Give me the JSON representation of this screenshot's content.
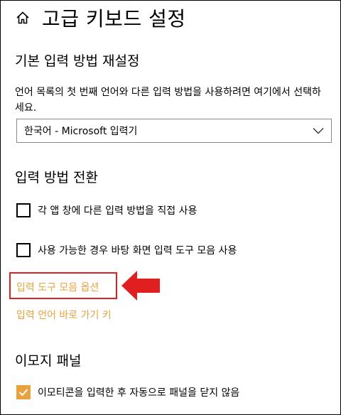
{
  "header": {
    "title": "고급 키보드 설정",
    "home_icon": "home-icon"
  },
  "default_input": {
    "title": "기본 입력 방법 재설정",
    "description": "언어 목록의 첫 번째 언어와 다른 입력 방법을 사용하려면 여기에서 선택하세요.",
    "selected": "한국어 - Microsoft 입력기"
  },
  "switching": {
    "title": "입력 방법 전환",
    "options": [
      {
        "label": "각 앱 창에 다른 입력 방법을 직접 사용",
        "checked": false
      },
      {
        "label": "사용 가능한 경우 바탕 화면 입력 도구 모음 사용",
        "checked": false
      }
    ],
    "links": {
      "toolbar_options": "입력 도구 모음 옵션",
      "hotkeys": "입력 언어 바로 가기 키"
    }
  },
  "emoji": {
    "title": "이모지 패널",
    "option": {
      "label": "이모티콘을 입력한 후 자동으로 패널을 닫지 않음",
      "checked": true
    }
  },
  "colors": {
    "accent": "#e8a13c",
    "highlight": "#e02020"
  }
}
